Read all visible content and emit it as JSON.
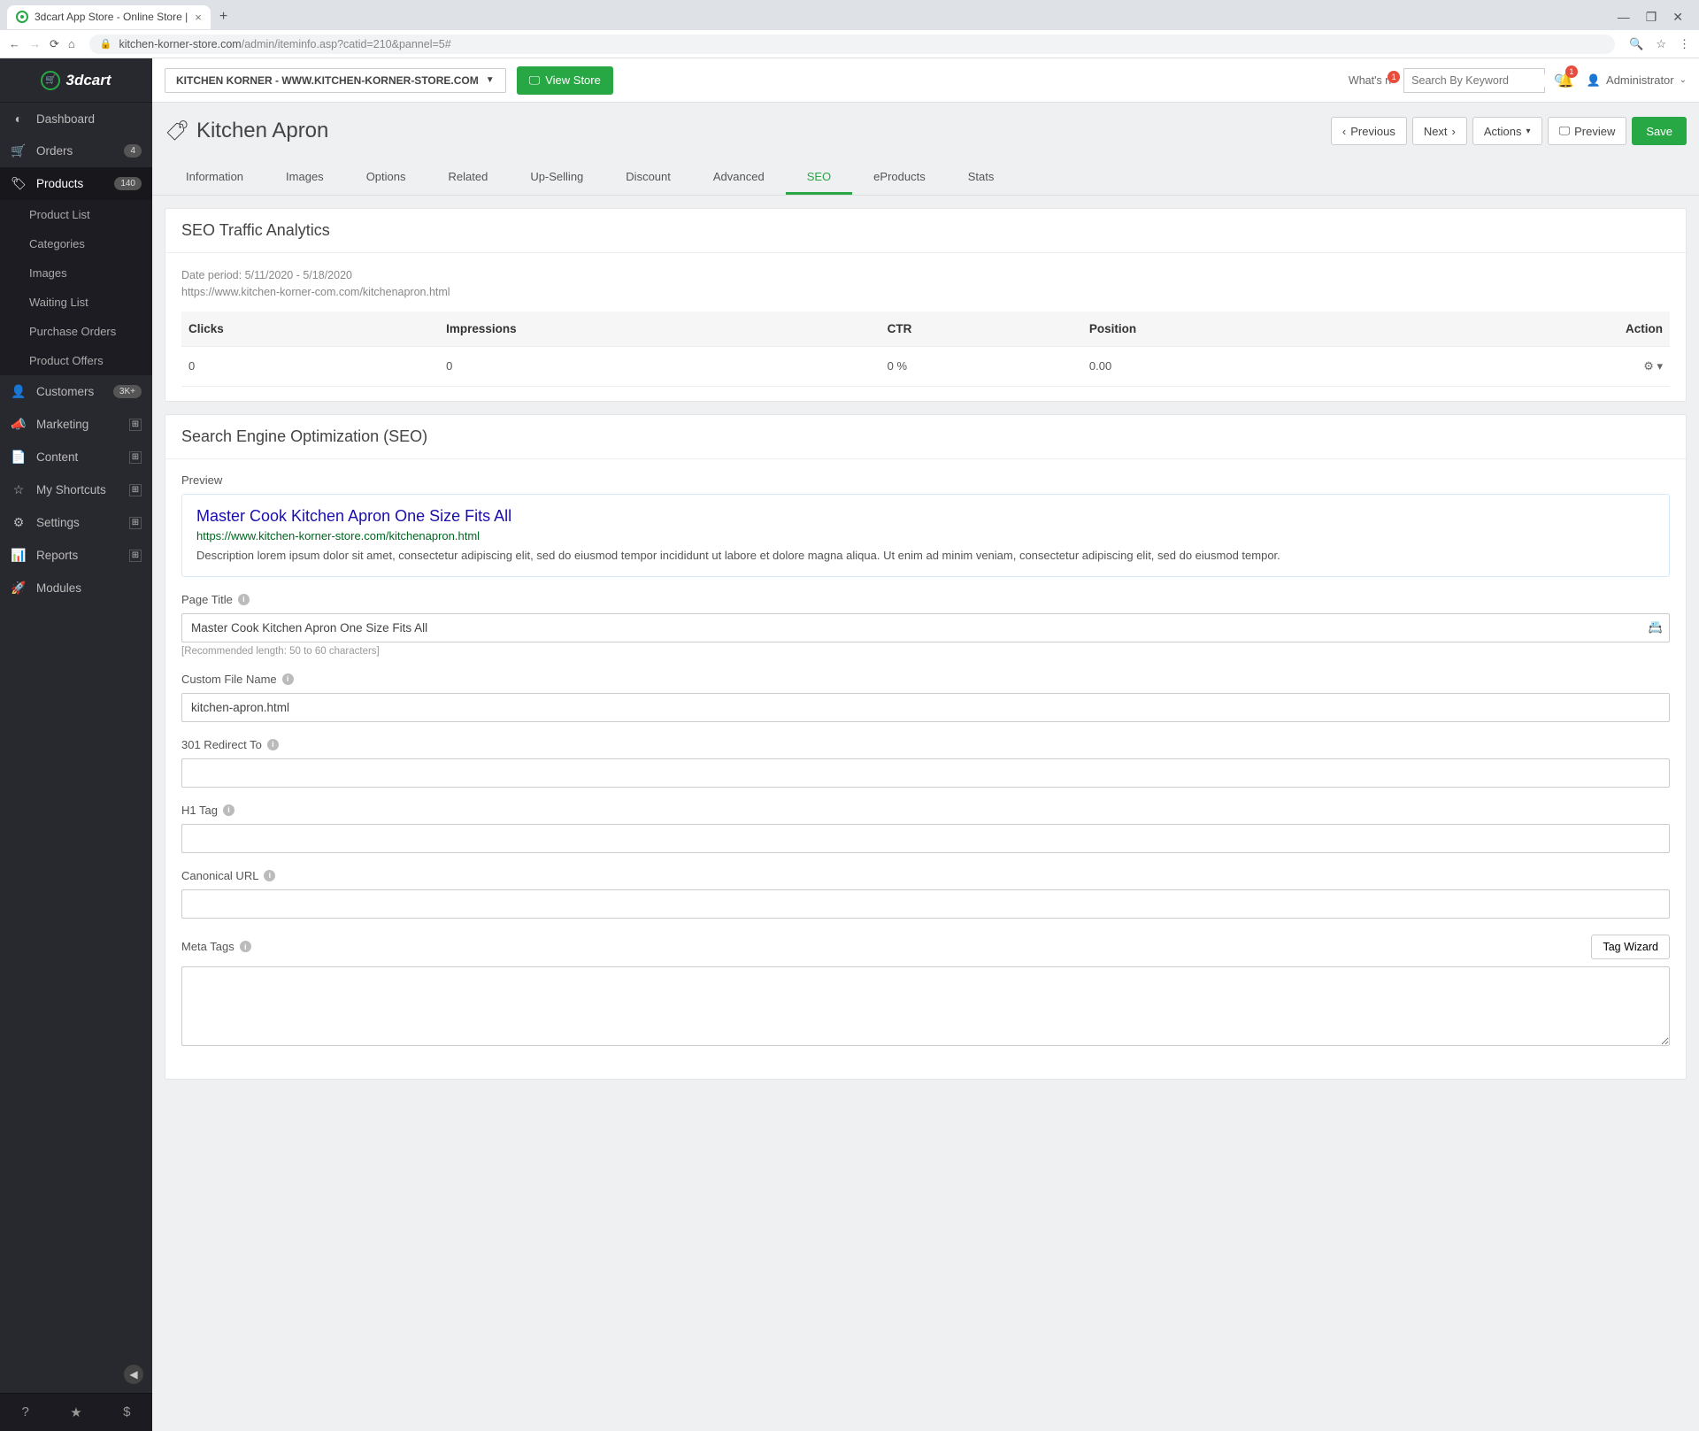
{
  "browser": {
    "tab_title": "3dcart App Store - Online Store |",
    "url_host": "kitchen-korner-store.com",
    "url_path": "/admin/iteminfo.asp?catid=210&pannel=5#"
  },
  "brand": {
    "name": "3dcart"
  },
  "sidebar": {
    "items": [
      {
        "icon": "gauge-icon",
        "label": "Dashboard"
      },
      {
        "icon": "cart-icon",
        "label": "Orders",
        "badge": "4"
      },
      {
        "icon": "tag-icon",
        "label": "Products",
        "badge": "140",
        "active": true
      },
      {
        "icon": "user-icon",
        "label": "Customers",
        "badge": "3K+"
      },
      {
        "icon": "bullhorn-icon",
        "label": "Marketing",
        "expand": true
      },
      {
        "icon": "file-icon",
        "label": "Content",
        "expand": true
      },
      {
        "icon": "star-icon",
        "label": "My Shortcuts",
        "expand": true
      },
      {
        "icon": "cogs-icon",
        "label": "Settings",
        "expand": true
      },
      {
        "icon": "chart-icon",
        "label": "Reports",
        "expand": true
      },
      {
        "icon": "rocket-icon",
        "label": "Modules"
      }
    ],
    "sub_items": [
      "Product List",
      "Categories",
      "Images",
      "Waiting List",
      "Purchase Orders",
      "Product Offers"
    ]
  },
  "topbar": {
    "store_name": "KITCHEN KORNER - WWW.KITCHEN-KORNER-STORE.COM",
    "view_store": "View Store",
    "whats_new": "What's n",
    "whats_new_count": "1",
    "bell_count": "1",
    "search_placeholder": "Search By Keyword",
    "user_label": "Administrator"
  },
  "page": {
    "title": "Kitchen Apron",
    "actions": {
      "previous": "Previous",
      "next": "Next",
      "actions": "Actions",
      "preview": "Preview",
      "save": "Save"
    }
  },
  "tabs": [
    "Information",
    "Images",
    "Options",
    "Related",
    "Up-Selling",
    "Discount",
    "Advanced",
    "SEO",
    "eProducts",
    "Stats"
  ],
  "active_tab": "SEO",
  "analytics": {
    "title": "SEO Traffic Analytics",
    "date_period": "Date period: 5/11/2020 - 5/18/2020",
    "url": "https://www.kitchen-korner-com.com/kitchenapron.html",
    "headers": {
      "clicks": "Clicks",
      "impressions": "Impressions",
      "ctr": "CTR",
      "position": "Position",
      "action": "Action"
    },
    "row": {
      "clicks": "0",
      "impressions": "0",
      "ctr": "0 %",
      "position": "0.00"
    }
  },
  "seo": {
    "title": "Search Engine Optimization (SEO)",
    "preview_label": "Preview",
    "preview": {
      "title": "Master Cook Kitchen Apron One Size Fits All",
      "url": "https://www.kitchen-korner-store.com/kitchenapron.html",
      "desc": "Description lorem ipsum dolor sit amet, consectetur adipiscing elit, sed do eiusmod tempor incididunt ut labore et dolore magna aliqua. Ut enim ad minim veniam, consectetur adipiscing elit, sed do eiusmod tempor."
    },
    "fields": {
      "page_title": {
        "label": "Page Title",
        "value": "Master Cook Kitchen Apron One Size Fits All",
        "hint": "[Recommended length: 50 to 60 characters]"
      },
      "custom_file": {
        "label": "Custom File Name",
        "value": "kitchen-apron.html"
      },
      "redirect": {
        "label": "301 Redirect To",
        "value": ""
      },
      "h1": {
        "label": "H1 Tag",
        "value": ""
      },
      "canonical": {
        "label": "Canonical URL",
        "value": ""
      },
      "meta": {
        "label": "Meta Tags",
        "value": "",
        "wizard": "Tag Wizard"
      }
    }
  },
  "icons": {
    "gauge-icon": "◐",
    "cart-icon": "🛒",
    "tag-icon": "🏷",
    "user-icon": "👤",
    "bullhorn-icon": "📣",
    "file-icon": "📄",
    "star-icon": "☆",
    "cogs-icon": "⚙",
    "chart-icon": "📊",
    "rocket-icon": "🚀"
  }
}
